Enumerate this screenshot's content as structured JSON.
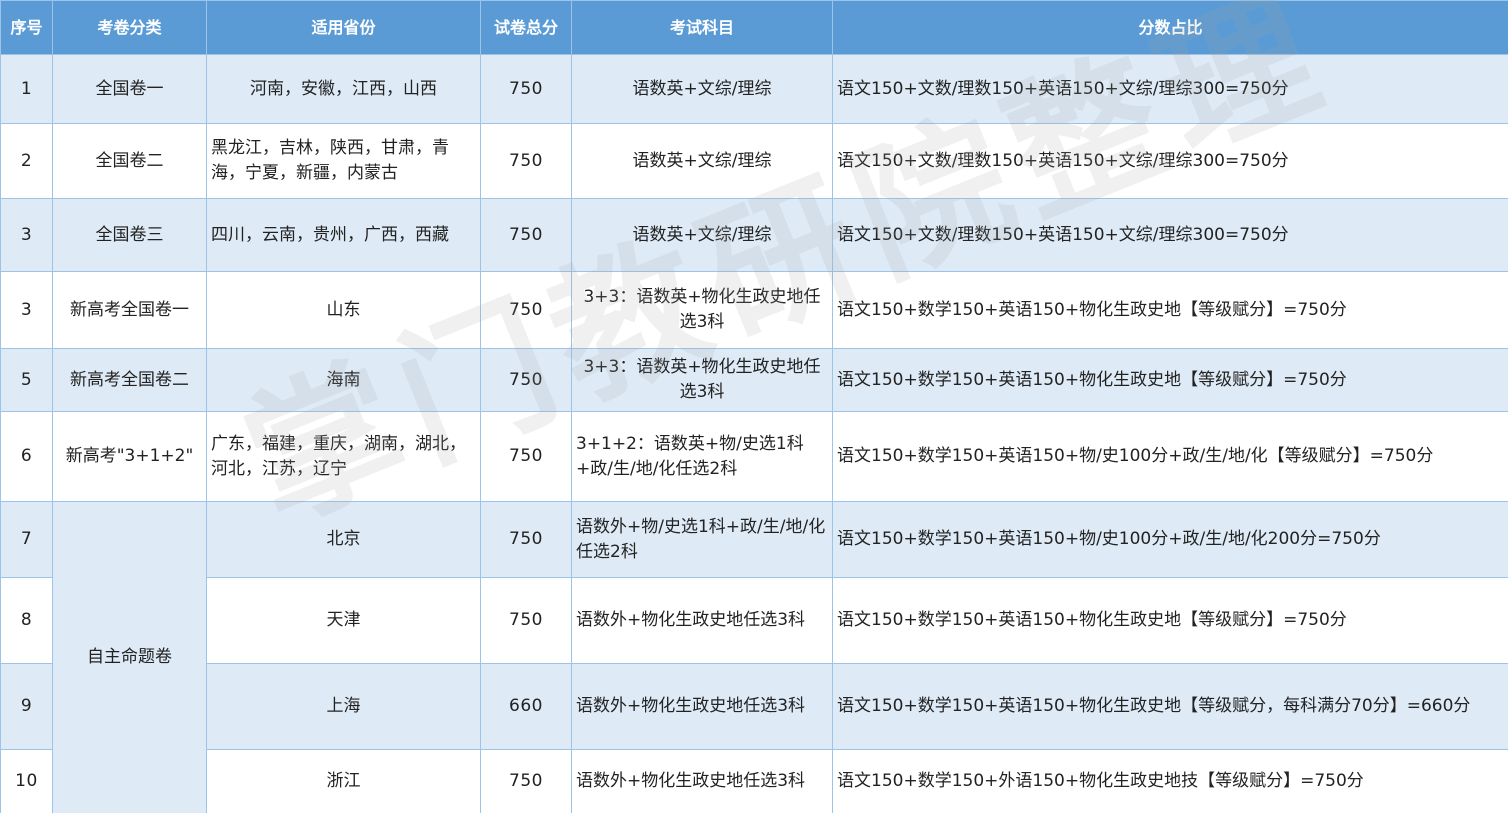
{
  "headers": [
    "序号",
    "考卷分类",
    "适用省份",
    "试卷总分",
    "考试科目",
    "分数占比"
  ],
  "rows": [
    {
      "no": "1",
      "category": "全国卷一",
      "provinces": "河南，安徽，江西，山西",
      "total": "750",
      "subjects": "语数英+文综/理综",
      "ratio": "语文150+文数/理数150+英语150+文综/理综300=750分"
    },
    {
      "no": "2",
      "category": "全国卷二",
      "provinces": "黑龙江，吉林，陕西，甘肃，青海，宁夏，新疆，内蒙古",
      "total": "750",
      "subjects": "语数英+文综/理综",
      "ratio": "语文150+文数/理数150+英语150+文综/理综300=750分"
    },
    {
      "no": "3",
      "category": "全国卷三",
      "provinces": "四川，云南，贵州，广西，西藏",
      "total": "750",
      "subjects": "语数英+文综/理综",
      "ratio": "语文150+文数/理数150+英语150+文综/理综300=750分"
    },
    {
      "no": "3",
      "category": "新高考全国卷一",
      "provinces": "山东",
      "total": "750",
      "subjects": "3+3：语数英+物化生政史地任选3科",
      "ratio": "语文150+数学150+英语150+物化生政史地【等级赋分】=750分"
    },
    {
      "no": "5",
      "category": "新高考全国卷二",
      "provinces": "海南",
      "total": "750",
      "subjects": "3+3：语数英+物化生政史地任选3科",
      "ratio": "语文150+数学150+英语150+物化生政史地【等级赋分】=750分"
    },
    {
      "no": "6",
      "category": "新高考\"3+1+2\"",
      "provinces": "广东，福建，重庆，湖南，湖北，河北，江苏，辽宁",
      "total": "750",
      "subjects": "3+1+2：语数英+物/史选1科+政/生/地/化任选2科",
      "ratio": "语文150+数学150+英语150+物/史100分+政/生/地/化【等级赋分】=750分"
    },
    {
      "no": "7",
      "category": "自主命题卷",
      "provinces": "北京",
      "total": "750",
      "subjects": "语数外+物/史选1科+政/生/地/化任选2科",
      "ratio": "语文150+数学150+英语150+物/史100分+政/生/地/化200分=750分"
    },
    {
      "no": "8",
      "category": "",
      "provinces": "天津",
      "total": "750",
      "subjects": "语数外+物化生政史地任选3科",
      "ratio": "语文150+数学150+英语150+物化生政史地【等级赋分】=750分"
    },
    {
      "no": "9",
      "category": "",
      "provinces": "上海",
      "total": "660",
      "subjects": "语数外+物化生政史地任选3科",
      "ratio": "语文150+数学150+英语150+物化生政史地【等级赋分，每科满分70分】=660分"
    },
    {
      "no": "10",
      "category": "",
      "provinces": "浙江",
      "total": "750",
      "subjects": "语数外+物化生政史地任选3科",
      "ratio": "语文150+数学150+外语150+物化生政史地技【等级赋分】=750分"
    }
  ],
  "watermark": "掌门教研院整理"
}
